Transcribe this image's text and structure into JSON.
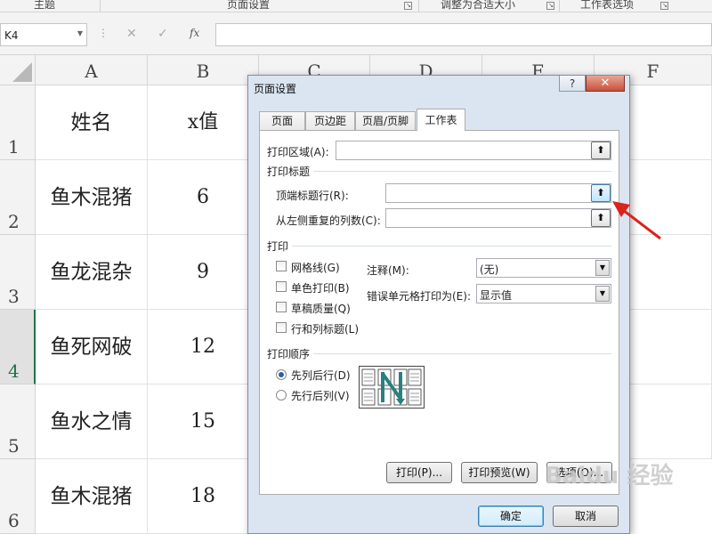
{
  "ribbon": {
    "groups": [
      "主题",
      "页面设置",
      "调整为合适大小",
      "工作表选项"
    ]
  },
  "formula_bar": {
    "name_box": "K4",
    "cancel_icon": "✕",
    "enter_icon": "✓",
    "fx_label": "fx",
    "formula": ""
  },
  "sheet": {
    "columns": [
      "A",
      "B",
      "C",
      "D",
      "E",
      "F"
    ],
    "rows": [
      "1",
      "2",
      "3",
      "4",
      "5",
      "6"
    ],
    "active_row": "4",
    "data": [
      [
        "姓名",
        "x值"
      ],
      [
        "鱼木混猪",
        "6"
      ],
      [
        "鱼龙混杂",
        "9"
      ],
      [
        "鱼死网破",
        "12"
      ],
      [
        "鱼水之情",
        "15"
      ],
      [
        "鱼木混猪",
        "18"
      ]
    ]
  },
  "dialog": {
    "title": "页面设置",
    "help": "?",
    "close": "✕",
    "tabs": [
      "页面",
      "页边距",
      "页眉/页脚",
      "工作表"
    ],
    "active_tab": "工作表",
    "print_area_label": "打印区域(A):",
    "print_area_value": "",
    "print_titles_section": "打印标题",
    "rows_to_repeat_label": "顶端标题行(R):",
    "rows_to_repeat_value": "",
    "cols_to_repeat_label": "从左侧重复的列数(C):",
    "cols_to_repeat_value": "",
    "print_section": "打印",
    "gridlines_label": "网格线(G)",
    "black_white_label": "单色打印(B)",
    "draft_label": "草稿质量(Q)",
    "headings_label": "行和列标题(L)",
    "comments_label": "注释(M):",
    "comments_value": "(无)",
    "errors_label": "错误单元格打印为(E):",
    "errors_value": "显示值",
    "order_section": "打印顺序",
    "down_then_over": "先列后行(D)",
    "over_then_down": "先行后列(V)",
    "down_then_over_selected": true,
    "print_btn": "打印(P)...",
    "preview_btn": "打印预览(W)",
    "options_btn": "选项(O)...",
    "ok_btn": "确定",
    "cancel_btn": "取消",
    "ref_icon": "⬆"
  },
  "watermark": "Baidu 经验",
  "colors": {
    "accent_green": "#217346",
    "annotation_red": "#d9231d"
  }
}
